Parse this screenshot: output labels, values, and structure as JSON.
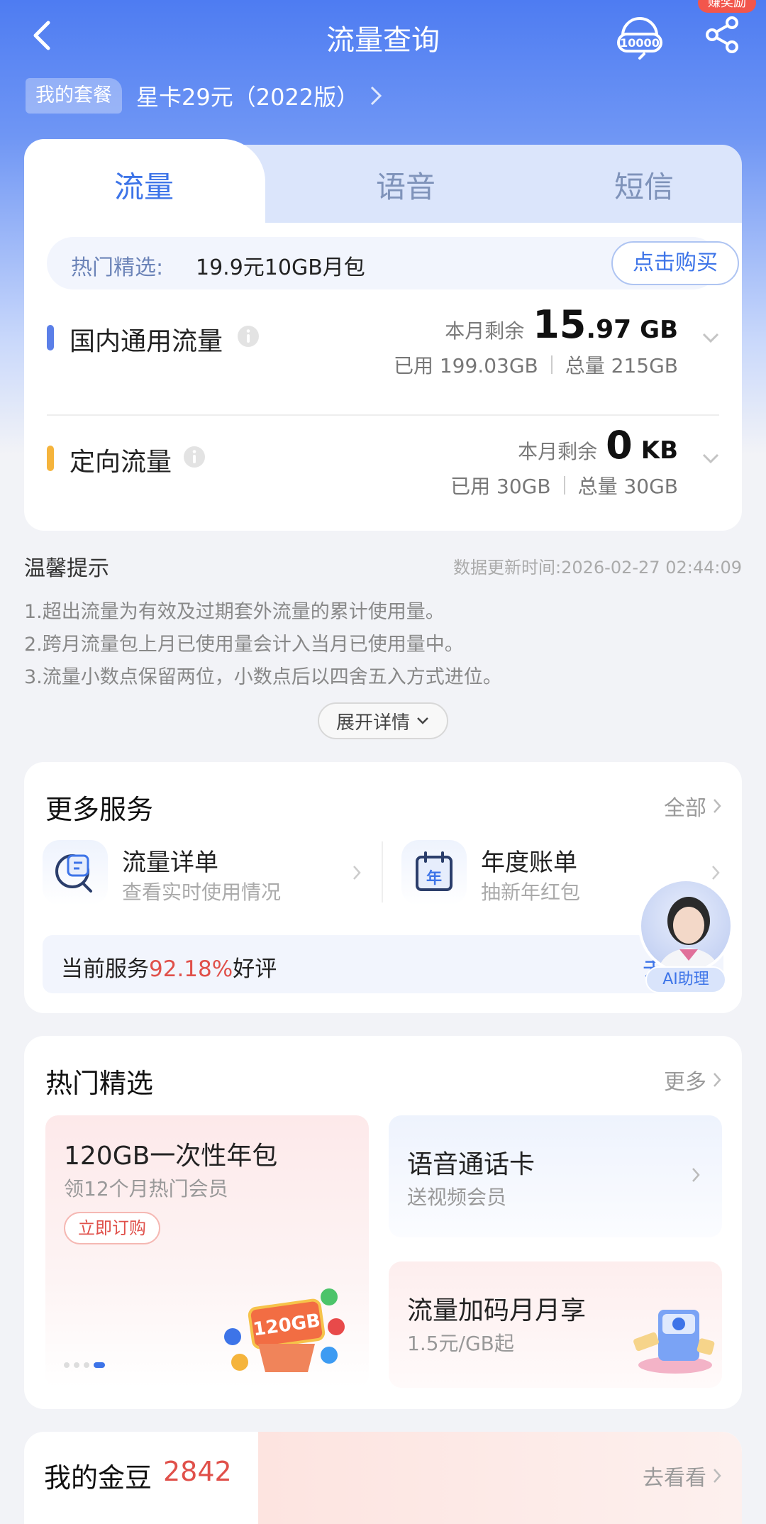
{
  "header": {
    "title": "流量查询",
    "reward_badge": "赚奖励",
    "hotline_label": "10000"
  },
  "plan": {
    "tag": "我的套餐",
    "name": "星卡29元（2022版）"
  },
  "tabs": [
    {
      "label": "流量",
      "active": true
    },
    {
      "label": "语音",
      "active": false
    },
    {
      "label": "短信",
      "active": false
    }
  ],
  "promo": {
    "label": "热门精选:",
    "text": "19.9元10GB月包",
    "button": "点击购买"
  },
  "usage": [
    {
      "name": "国内通用流量",
      "color": "#5b7fe8",
      "remain_label": "本月剩余",
      "remain_int": "15",
      "remain_dec": ".97",
      "remain_unit": "GB",
      "used": "已用 199.03GB",
      "total": "总量 215GB"
    },
    {
      "name": "定向流量",
      "color": "#f5b43c",
      "remain_label": "本月剩余",
      "remain_int": "0",
      "remain_dec": "",
      "remain_unit": "KB",
      "used": "已用 30GB",
      "total": "总量 30GB"
    }
  ],
  "tips": {
    "title": "温馨提示",
    "update_time": "数据更新时间:2026-02-27 02:44:09",
    "items": [
      "1.超出流量为有效及过期套外流量的累计使用量。",
      "2.跨月流量包上月已使用量会计入当月已使用量中。",
      "3.流量小数点保留两位，小数点后以四舍五入方式进位。"
    ],
    "expand": "展开详情"
  },
  "services": {
    "title": "更多服务",
    "more": "全部",
    "items": [
      {
        "name": "流量详单",
        "sub": "查看实时使用情况"
      },
      {
        "name": "年度账单",
        "sub": "抽新年红包",
        "icon_text": "年"
      }
    ],
    "rating_prefix": "当前服务",
    "rating_pct": "92.18%",
    "rating_suffix": "好评",
    "rating_go": "去",
    "ai_label": "AI助理"
  },
  "hot": {
    "title": "热门精选",
    "more": "更多",
    "left": {
      "title": "120GB一次性年包",
      "sub": "领12个月热门会员",
      "button": "立即订购",
      "art_label": "120GB"
    },
    "right": [
      {
        "title": "语音通话卡",
        "sub": "送视频会员"
      },
      {
        "title": "流量加码月月享",
        "sub": "1.5元/GB起"
      }
    ]
  },
  "coins": {
    "title": "我的金豆",
    "count": "2842",
    "more": "去看看"
  }
}
